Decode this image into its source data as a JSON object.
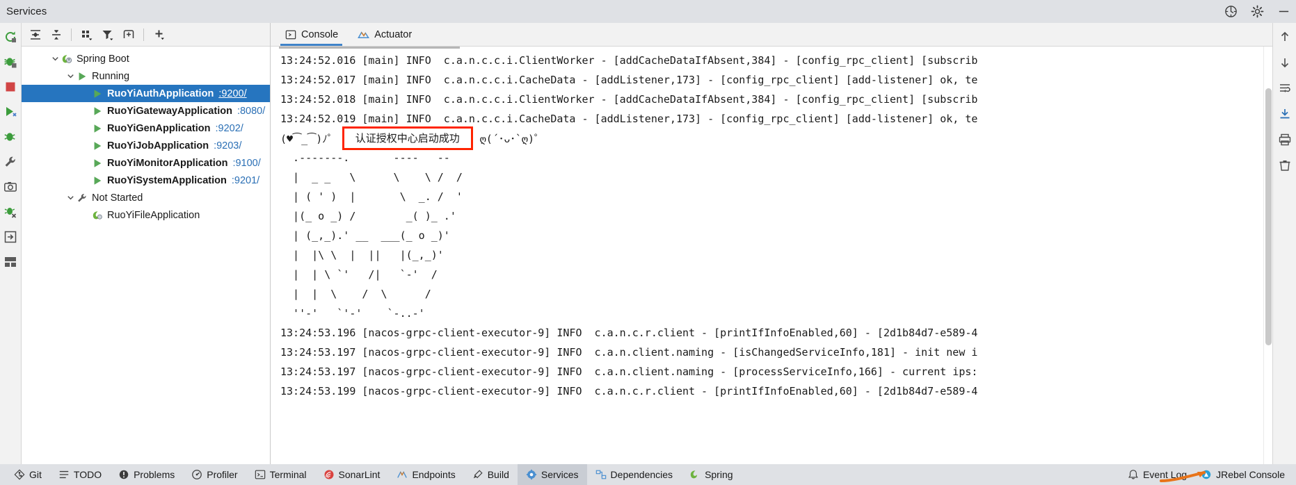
{
  "window": {
    "title": "Services",
    "icons": [
      {
        "name": "settings-sync-icon",
        "glyph": "sync"
      },
      {
        "name": "gear-icon",
        "glyph": "gear"
      },
      {
        "name": "minimize-icon",
        "glyph": "minimize"
      }
    ]
  },
  "left_strip": {
    "items": [
      {
        "name": "rerun-icon",
        "title": "Rerun"
      },
      {
        "name": "debug-icon",
        "title": "Debug"
      },
      {
        "name": "stop-icon",
        "title": "Stop"
      },
      {
        "name": "run-with-coverage-icon",
        "title": "Run with Coverage"
      },
      {
        "name": "profiler-icon",
        "title": "Profiler"
      },
      {
        "name": "wrench-icon",
        "title": "Settings"
      },
      {
        "name": "camera-icon",
        "title": "Capture Snapshot"
      },
      {
        "name": "thread-dump-icon",
        "title": "Thread Dump"
      },
      {
        "name": "attach-icon",
        "title": "Attach"
      },
      {
        "name": "layout-icon",
        "title": "Layout"
      }
    ]
  },
  "tree_toolbar": {
    "items": [
      {
        "name": "expand-all-icon",
        "title": "Expand All"
      },
      {
        "name": "collapse-all-icon",
        "title": "Collapse All"
      },
      {
        "name": "group-by-icon",
        "title": "Group By"
      },
      {
        "name": "filter-icon",
        "title": "Filter"
      },
      {
        "name": "add-tab-icon",
        "title": "Add Tab"
      },
      {
        "name": "add-service-icon",
        "title": "Add Service"
      }
    ]
  },
  "tree": {
    "root": {
      "label": "Spring Boot",
      "icon": "spring-boot-icon",
      "expanded": true
    },
    "groups": [
      {
        "label": "Running",
        "icon": "run-green-icon",
        "expanded": true,
        "items": [
          {
            "label": "RuoYiAuthApplication",
            "port": ":9200/",
            "icon": "run-green-icon",
            "selected": true
          },
          {
            "label": "RuoYiGatewayApplication",
            "port": ":8080/",
            "icon": "run-green-icon",
            "selected": false
          },
          {
            "label": "RuoYiGenApplication",
            "port": ":9202/",
            "icon": "run-green-icon",
            "selected": false
          },
          {
            "label": "RuoYiJobApplication",
            "port": ":9203/",
            "icon": "run-green-icon",
            "selected": false
          },
          {
            "label": "RuoYiMonitorApplication",
            "port": ":9100/",
            "icon": "run-green-icon",
            "selected": false
          },
          {
            "label": "RuoYiSystemApplication",
            "port": ":9201/",
            "icon": "run-green-icon",
            "selected": false
          }
        ]
      },
      {
        "label": "Not Started",
        "icon": "wrench-gray-icon",
        "expanded": true,
        "items": [
          {
            "label": "RuoYiFileApplication",
            "port": "",
            "icon": "spring-leaf-icon",
            "selected": false
          }
        ]
      }
    ]
  },
  "console": {
    "tabs": [
      {
        "label": "Console",
        "icon": "console-icon",
        "active": true
      },
      {
        "label": "Actuator",
        "icon": "actuator-icon",
        "active": false
      }
    ],
    "log_lines_top": [
      "13:24:52.016 [main] INFO  c.a.n.c.c.i.ClientWorker - [addCacheDataIfAbsent,384] - [config_rpc_client] [subscrib",
      "13:24:52.017 [main] INFO  c.a.n.c.c.i.CacheData - [addListener,173] - [config_rpc_client] [add-listener] ok, te",
      "13:24:52.018 [main] INFO  c.a.n.c.c.i.ClientWorker - [addCacheDataIfAbsent,384] - [config_rpc_client] [subscrib",
      "13:24:52.019 [main] INFO  c.a.n.c.c.i.CacheData - [addListener,173] - [config_rpc_client] [add-listener] ok, te"
    ],
    "banner": {
      "left_emoticon": "(♥⁀_⁀)ﾉ゜",
      "highlight_text": "认证授权中心启动成功",
      "highlight_border_color": "#ff2400",
      "right_emoticon": "ღ(´･ᴗ･`ღ)゜"
    },
    "ascii_art": [
      "  .-------.       ----   --",
      "  |  _ _   \\      \\    \\ /  /",
      "  | ( ' )  |       \\  _. /  '",
      "  |(_ o _) /        _( )_ .'",
      "  | (_,_).' __  ___(_ o _)'",
      "  |  |\\ \\  |  ||   |(_,_)'",
      "  |  | \\ `'   /|   `-'  /",
      "  |  |  \\    /  \\      /",
      "  ''-'   `'-'    `-..-'"
    ],
    "log_lines_bottom": [
      "13:24:53.196 [nacos-grpc-client-executor-9] INFO  c.a.n.c.r.client - [printIfInfoEnabled,60] - [2d1b84d7-e589-4",
      "13:24:53.197 [nacos-grpc-client-executor-9] INFO  c.a.n.client.naming - [isChangedServiceInfo,181] - init new i",
      "13:24:53.197 [nacos-grpc-client-executor-9] INFO  c.a.n.client.naming - [processServiceInfo,166] - current ips:",
      "13:24:53.199 [nacos-grpc-client-executor-9] INFO  c.a.n.c.r.client - [printIfInfoEnabled,60] - [2d1b84d7-e589-4"
    ]
  },
  "right_strip": {
    "items": [
      {
        "name": "scroll-up-icon",
        "title": "Up"
      },
      {
        "name": "scroll-down-icon",
        "title": "Down"
      },
      {
        "name": "soft-wrap-icon",
        "title": "Soft-Wrap"
      },
      {
        "name": "scroll-to-end-icon",
        "title": "Scroll to End"
      },
      {
        "name": "print-icon",
        "title": "Print"
      },
      {
        "name": "trash-icon",
        "title": "Clear All"
      }
    ]
  },
  "statusbar": {
    "left_items": [
      {
        "label": "Git",
        "icon": "git-icon",
        "active": false
      },
      {
        "label": "TODO",
        "icon": "todo-icon",
        "active": false
      },
      {
        "label": "Problems",
        "icon": "problems-icon",
        "active": false
      },
      {
        "label": "Profiler",
        "icon": "profiler-icon",
        "active": false
      },
      {
        "label": "Terminal",
        "icon": "terminal-icon",
        "active": false
      },
      {
        "label": "SonarLint",
        "icon": "sonarlint-icon",
        "active": false
      },
      {
        "label": "Endpoints",
        "icon": "endpoints-icon",
        "active": false
      },
      {
        "label": "Build",
        "icon": "build-icon",
        "active": false
      },
      {
        "label": "Services",
        "icon": "services-icon",
        "active": true
      },
      {
        "label": "Dependencies",
        "icon": "dependencies-icon",
        "active": false
      },
      {
        "label": "Spring",
        "icon": "spring-icon",
        "active": false
      }
    ],
    "right_items": [
      {
        "label": "Event Log",
        "icon": "event-log-icon",
        "active": false
      },
      {
        "label": "JRebel Console",
        "icon": "jrebel-icon",
        "active": false
      }
    ]
  }
}
